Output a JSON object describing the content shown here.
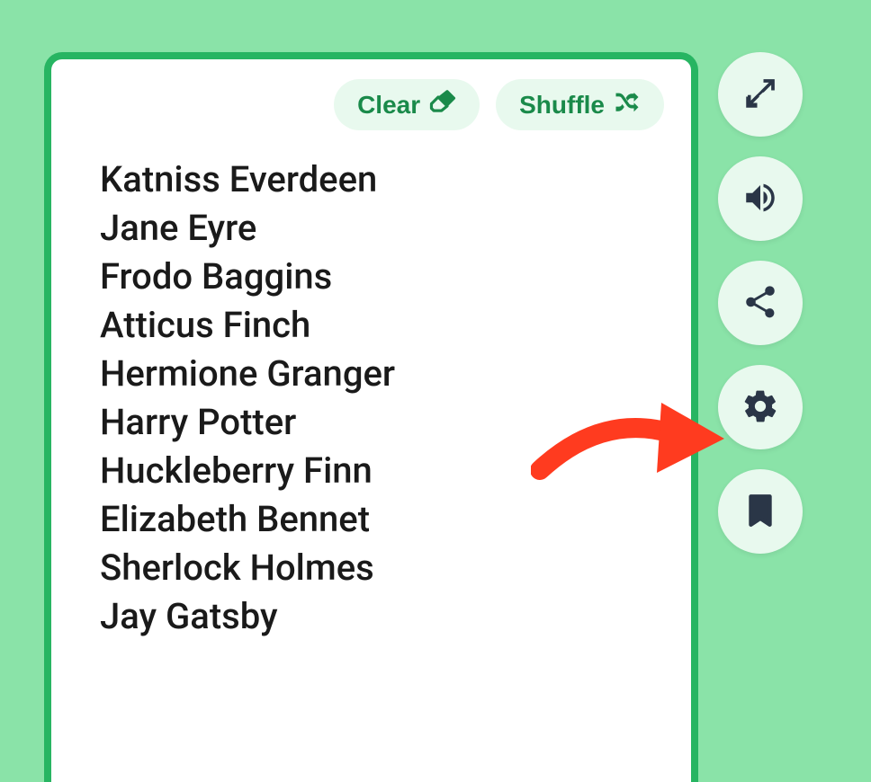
{
  "toolbar": {
    "clear_label": "Clear",
    "shuffle_label": "Shuffle"
  },
  "names": [
    "Katniss Everdeen",
    "Jane Eyre",
    "Frodo Baggins",
    "Atticus Finch",
    "Hermione Granger",
    "Harry Potter",
    "Huckleberry Finn",
    "Elizabeth Bennet",
    "Sherlock Holmes",
    "Jay Gatsby"
  ],
  "side_icons": {
    "expand": "expand-icon",
    "sound": "sound-icon",
    "share": "share-icon",
    "settings": "gear-icon",
    "bookmark": "bookmark-icon"
  }
}
